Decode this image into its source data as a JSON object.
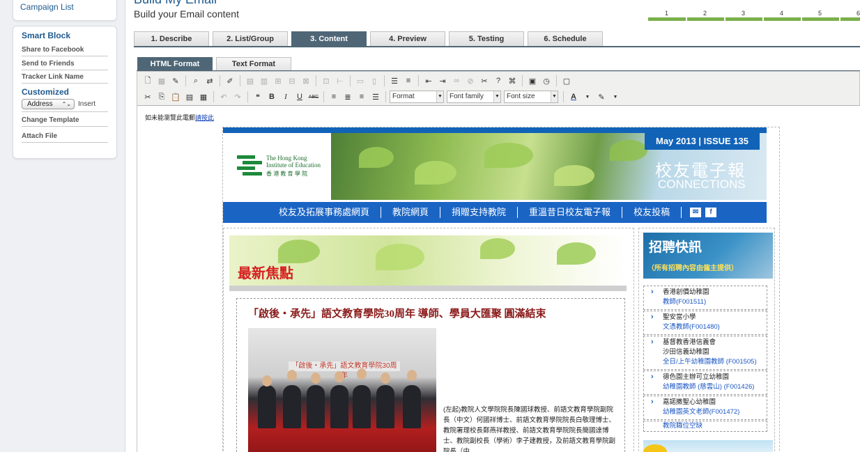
{
  "sidebar": {
    "campaign_list": "Campaign List",
    "smart_block_title": "Smart Block",
    "smart_items": [
      "Share to Facebook",
      "Send to Friends",
      "Tracker Link Name"
    ],
    "customized_title": "Customized",
    "address_select": "Address",
    "insert_label": "Insert",
    "bottom_items": [
      "Change Template",
      "Attach File"
    ]
  },
  "header": {
    "title": "Build My Email",
    "subtitle": "Build your Email content",
    "progress_steps": [
      "1",
      "2",
      "3",
      "4",
      "5",
      "6"
    ]
  },
  "steps": [
    "1. Describe",
    "2. List/Group",
    "3. Content",
    "4. Preview",
    "5. Testing",
    "6. Schedule"
  ],
  "active_step": "3. Content",
  "format_tabs": [
    "HTML Format",
    "Text Format"
  ],
  "toolbar": {
    "format_select": "Format",
    "font_family_select": "Font family",
    "font_size_select": "Font size"
  },
  "email": {
    "notice_text": "如未能瀏覽此電郵",
    "notice_link": "請按此",
    "issue": "May 2013 | ISSUE 135",
    "zh_title": "校友電子報",
    "en_title": "CONNECTIONS",
    "logo_line1": "The Hong Kong",
    "logo_line2": "Institute of Education",
    "logo_line3": "香 港 教 育 學 院",
    "nav": [
      "校友及拓展事務處網頁",
      "教院網頁",
      "捐贈支持教院",
      "重溫昔日校友電子報",
      "校友投稿"
    ],
    "feature_label": "最新焦點",
    "article_title": "「啟後・承先」語文教育學院30周年 導師、學員大匯聚 圓滿結束",
    "photo_banner": "「啟後・承先」語文教育學院30周年",
    "caption": "(左起)教院人文學院院長陳國球教授、前語文教育學院副院長（中文）何國祥博士、前語文教育學院院長白敬理博士、教院署理校長鄭燕祥教授、前語文教育學院院長簡國達博士、教院副校長（學術）李子建教授，及前語文教育學院副院長（中",
    "job_title": "招聘快訊",
    "job_sub": "（所有招聘內容由僱主提供）",
    "jobs": [
      {
        "org": "香港創價幼稚園",
        "pos": "教師(F001511)"
      },
      {
        "org": "聖安當小學",
        "pos": "文憑教師(F001480)"
      },
      {
        "org": "基督教香港信義會",
        "org2": "沙田信義幼稚園",
        "pos": "全日/上午幼稚園教師 (F001505)"
      },
      {
        "org": "德色園主辦可立幼稚園",
        "pos": "幼稚園教師 (慈雲山) (F001426)"
      },
      {
        "org": "嘉諾撒聖心幼稚園",
        "pos": "幼稚園英文老師(F001472)"
      }
    ],
    "jobs_more": "教院職位空缺"
  },
  "colors": {
    "brand_blue": "#1a64c4",
    "tab_active": "#4f6676",
    "progress_green": "#7ab04b",
    "headline_red": "#8b1a1a"
  }
}
